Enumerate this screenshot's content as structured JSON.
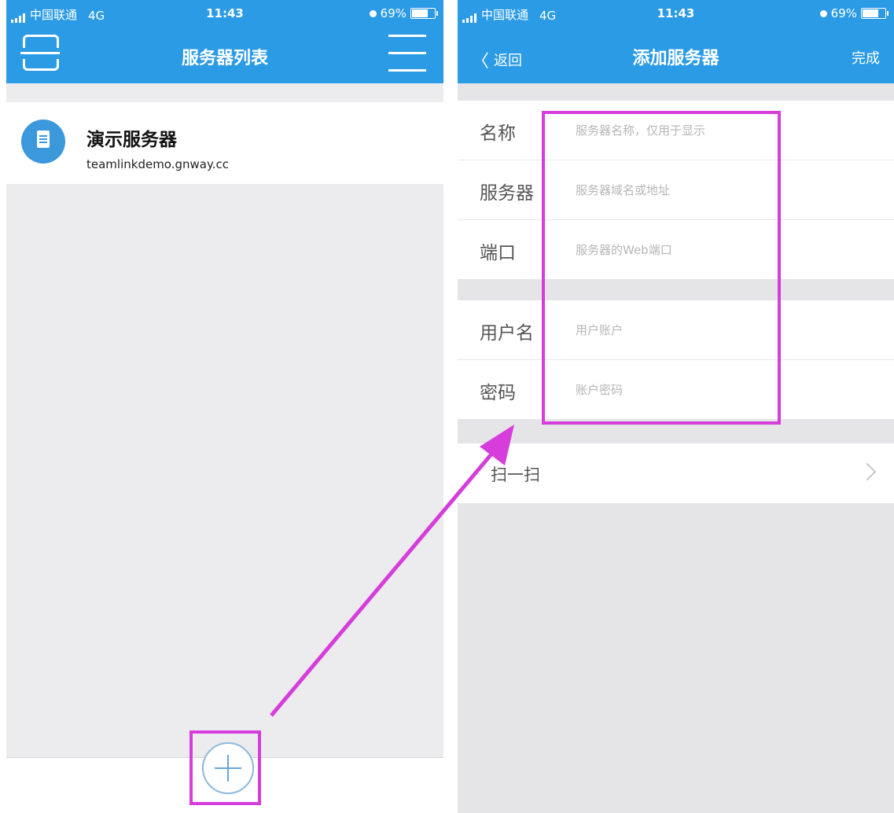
{
  "status_left": {
    "carrier": "中国联通",
    "network": "4G",
    "time": "11:43",
    "battery": "69%"
  },
  "status_right": {
    "carrier": "中国联通",
    "network": "4G",
    "time": "11:43",
    "battery": "69%"
  },
  "server_list": {
    "title": "服务器列表",
    "items": [
      {
        "name": "演示服务器",
        "host": "teamlinkdemo.gnway.cc"
      }
    ]
  },
  "add_server": {
    "back_label": "返回",
    "title": "添加服务器",
    "done_label": "完成",
    "fields": [
      {
        "label": "名称",
        "placeholder": "服务器名称，仅用于显示"
      },
      {
        "label": "服务器",
        "placeholder": "服务器域名或地址"
      },
      {
        "label": "端口",
        "placeholder": "服务器的Web端口"
      },
      {
        "label": "用户名",
        "placeholder": "用户账户"
      },
      {
        "label": "密码",
        "placeholder": "账户密码"
      }
    ],
    "scan_label": "扫一扫"
  },
  "colors": {
    "nav": "#2b9be6",
    "highlight": "#d63ddb",
    "avatar": "#3b98db"
  }
}
